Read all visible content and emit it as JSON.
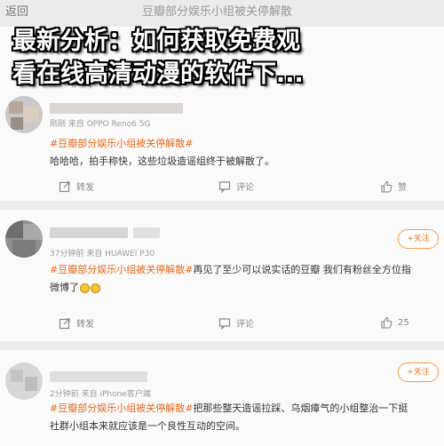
{
  "nav": {
    "back_label": "返回",
    "title": "豆瓣部分娱乐小组被关停解散"
  },
  "headline": {
    "line1": "最新分析：如何获取免费观",
    "line2": "看在线高清动漫的软件下..."
  },
  "icons": {
    "repost": "repost-icon",
    "comment": "comment-icon",
    "like": "thumbs-up-icon"
  },
  "colors": {
    "topic": "#e56a1e",
    "follow": "#e8751a"
  },
  "posts": [
    {
      "meta": "刚刚 来自 OPPO Reno6 5G",
      "topic": "#豆瓣部分娱乐小组被关停解散#",
      "text": "哈哈哈，拍手称快，这些垃圾造谣组终于被解散了。",
      "actions": {
        "repost": "转发",
        "comment": "评论",
        "like": "赞"
      }
    },
    {
      "meta": "37分钟前 来自 HUAWEI P30",
      "follow": "+关注",
      "topic": "#豆瓣部分娱乐小组被关停解散#",
      "text": "再见了至少可以说实话的豆瓣 我们有粉丝全方位指",
      "text2": "微博了",
      "actions": {
        "repost": "转发",
        "comment": "评论",
        "like": "25"
      }
    },
    {
      "meta": "2分钟前 来自 iPhone客户端",
      "follow": "+关注",
      "topic": "#豆瓣部分娱乐小组被关停解散#",
      "text": "把那些整天造谣拉踩、乌烟瘴气的小组整治一下挺",
      "text2": "社群小组本来就应该是一个良性互动的空间。"
    }
  ]
}
